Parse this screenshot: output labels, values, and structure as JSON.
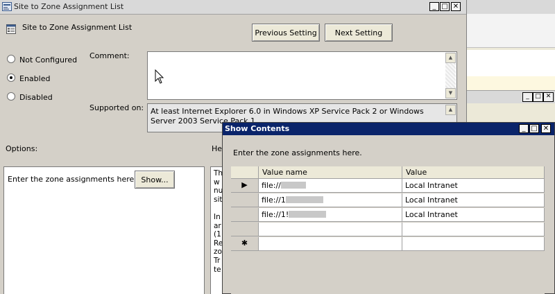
{
  "main_window": {
    "title": "Site to Zone Assignment List",
    "heading": "Site to Zone Assignment List",
    "buttons": {
      "previous": "Previous Setting",
      "next": "Next Setting"
    },
    "radios": [
      {
        "label": "Not Configured",
        "checked": false
      },
      {
        "label": "Enabled",
        "checked": true
      },
      {
        "label": "Disabled",
        "checked": false
      }
    ],
    "comment_label": "Comment:",
    "supported_label": "Supported on:",
    "supported_text": "At least Internet Explorer 6.0 in Windows XP Service Pack 2 or Windows Server 2003 Service Pack 1",
    "options_label": "Options:",
    "help_label": "He",
    "options_text": "Enter the zone assignments here.",
    "show_button": "Show...",
    "help_fragments": [
      "Th",
      "w",
      "nu",
      "sit",
      "",
      "In",
      "ar",
      "(1",
      "Re",
      "zo",
      "Tr",
      "te"
    ]
  },
  "caption_buttons": {
    "minimize": "_",
    "maximize": "□",
    "close": "✕"
  },
  "show_contents": {
    "title": "Show Contents",
    "instruction": "Enter the zone assignments here.",
    "columns": [
      "Value name",
      "Value"
    ],
    "rows": [
      {
        "indicator": "▶",
        "name": "file://",
        "value": "Local Intranet"
      },
      {
        "indicator": "",
        "name": "file://1",
        "value": "Local Intranet"
      },
      {
        "indicator": "",
        "name": "file://1!",
        "value": "Local Intranet"
      },
      {
        "indicator": "",
        "name": "",
        "value": ""
      },
      {
        "indicator": "✱",
        "name": "",
        "value": ""
      }
    ]
  },
  "colors": {
    "dialog_bg": "#d4d0c8",
    "active_title": "#0a246a",
    "background_highlight": "#fdf8e0"
  }
}
